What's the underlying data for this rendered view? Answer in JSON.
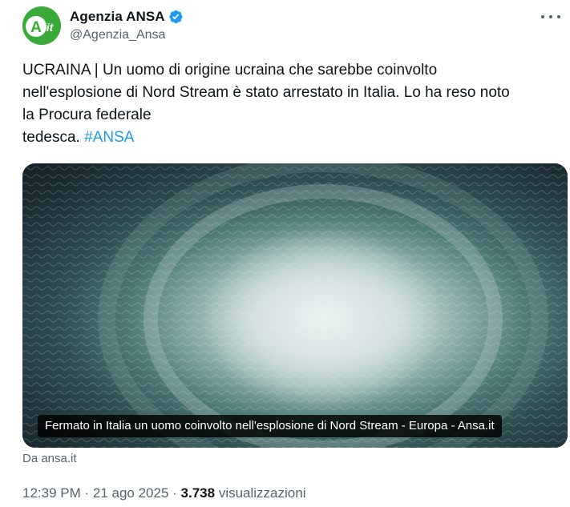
{
  "author": {
    "display_name": "Agenzia ANSA",
    "handle": "@Agenzia_Ansa",
    "avatar_text": "Ait"
  },
  "tweet": {
    "text_lines": [
      "UCRAINA | Un uomo di origine ucraina che sarebbe coinvolto",
      "nell'esplosione di Nord Stream è stato arrestato in Italia. Lo ha reso noto",
      "la Procura federale",
      "tedesca. "
    ],
    "hashtag": "#ANSA"
  },
  "card": {
    "caption": "Fermato in Italia un uomo coinvolto nell'esplosione di Nord Stream - Europa - Ansa.it",
    "source": "Da ansa.it"
  },
  "meta": {
    "time": "12:39 PM",
    "separator": " · ",
    "date": "21 ago 2025",
    "views_count": "3.738",
    "views_label": "visualizzazioni"
  },
  "colors": {
    "accent": "#1d9bf0",
    "secondary_text": "#536471",
    "avatar_green": "#3aaa3a"
  },
  "icons": [
    "verified-badge-icon",
    "more-options-icon"
  ]
}
